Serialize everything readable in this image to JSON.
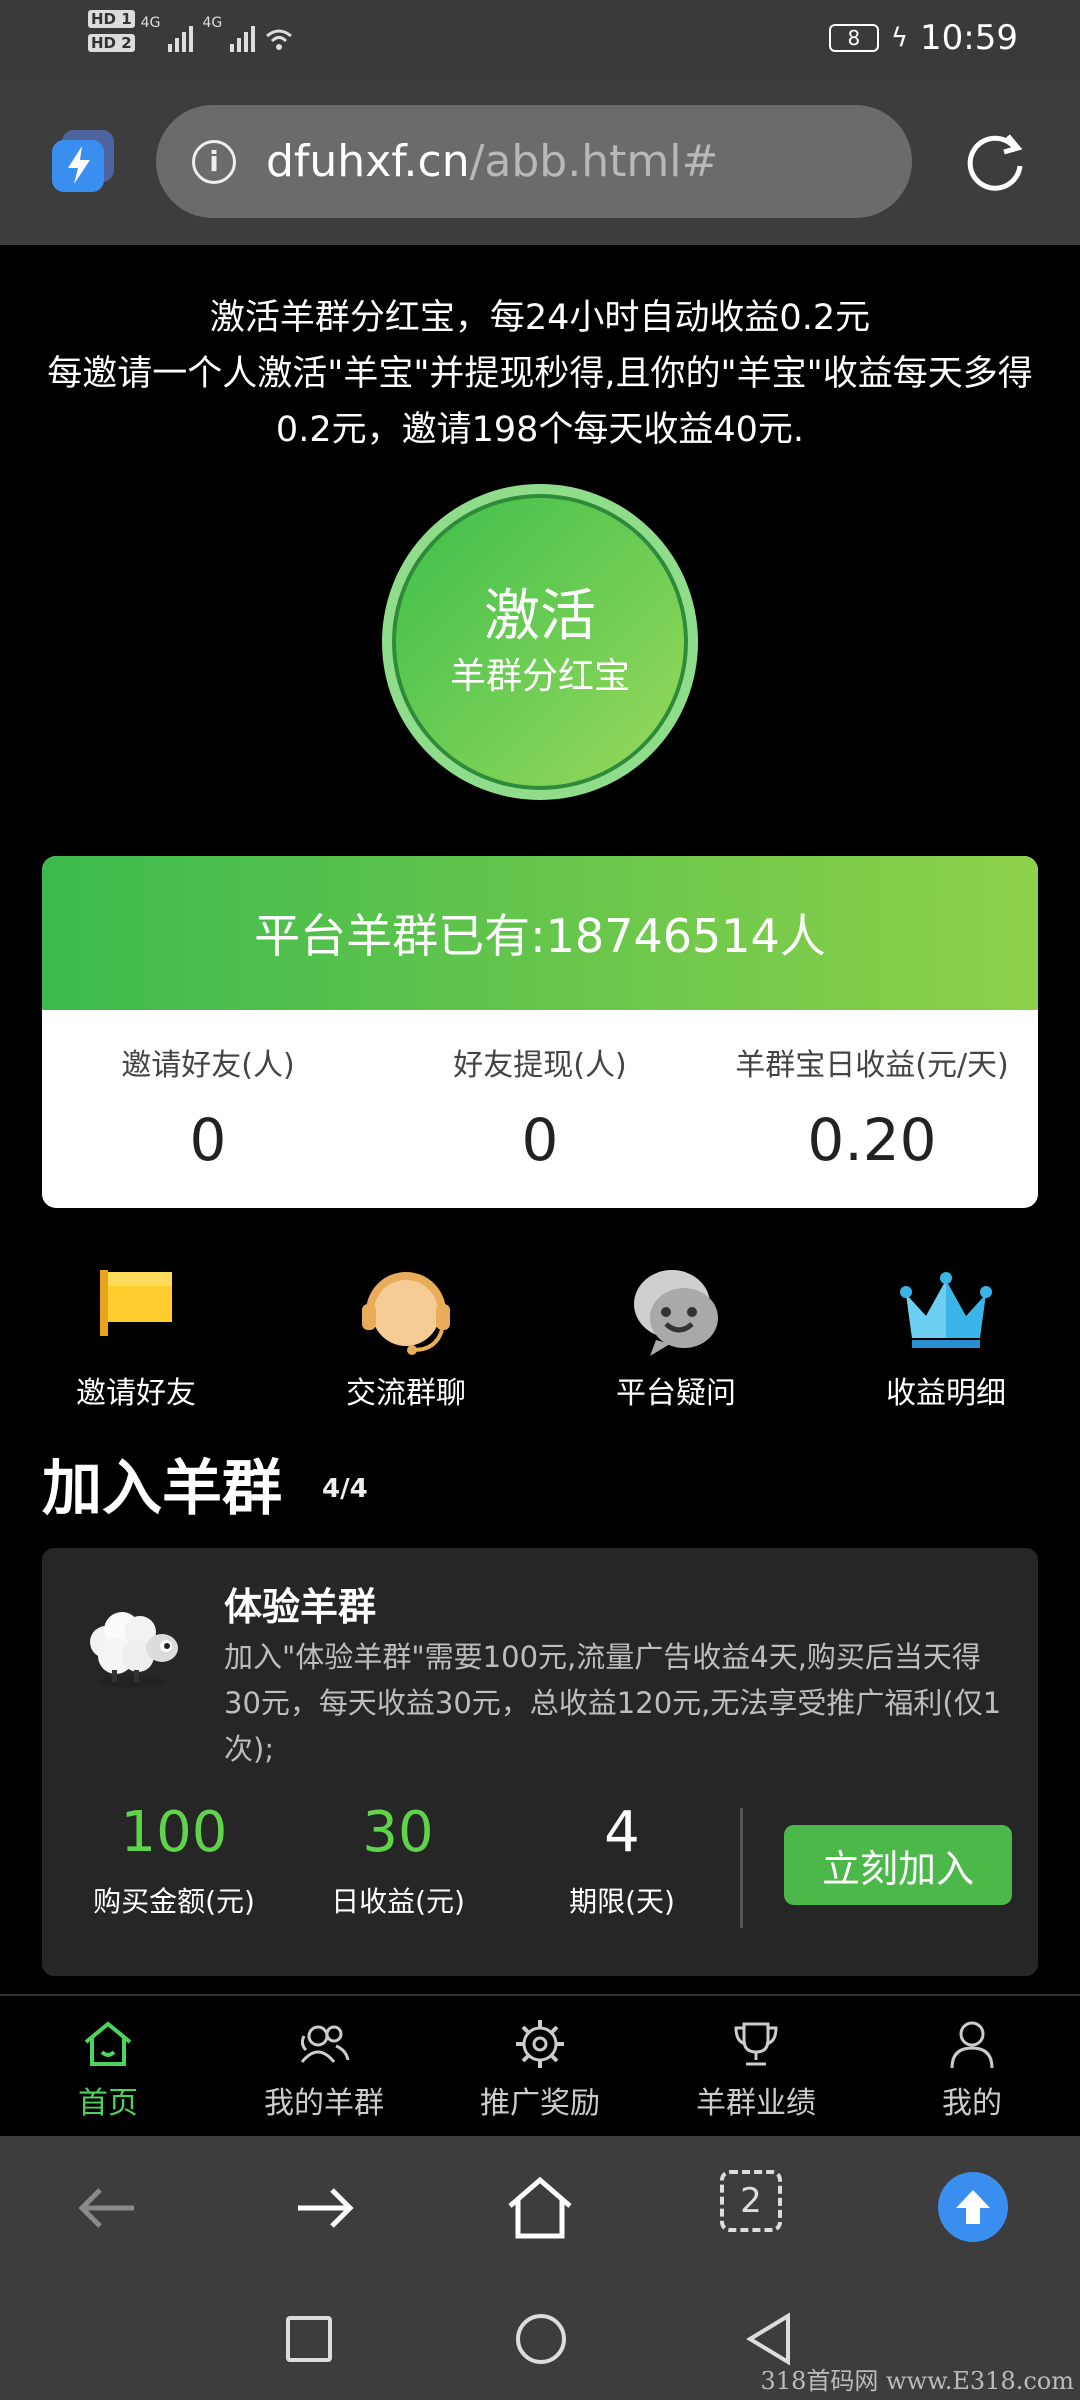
{
  "status_bar": {
    "sim1": "HD 1",
    "sim2": "HD 2",
    "net1": "4G",
    "net2": "4G",
    "battery": "8",
    "time": "10:59"
  },
  "browser": {
    "url_domain": "dfuhxf.cn",
    "url_path": "/abb.html#"
  },
  "intro": {
    "line1": "激活羊群分红宝，每24小时自动收益0.2元",
    "line2": "每邀请一个人激活\"羊宝\"并提现秒得,且你的\"羊宝\"收益每天多得0.2元，邀请198个每天收益40元."
  },
  "activate": {
    "main": "激活",
    "sub": "羊群分红宝"
  },
  "stats": {
    "headline": "平台羊群已有:18746514人",
    "items": [
      {
        "label": "邀请好友(人)",
        "value": "0"
      },
      {
        "label": "好友提现(人)",
        "value": "0"
      },
      {
        "label": "羊群宝日收益(元/天)",
        "value": "0.20"
      }
    ]
  },
  "quick_links": [
    {
      "label": "邀请好友",
      "icon": "flag-icon"
    },
    {
      "label": "交流群聊",
      "icon": "headset-icon"
    },
    {
      "label": "平台疑问",
      "icon": "chat-icon"
    },
    {
      "label": "收益明细",
      "icon": "crown-icon"
    }
  ],
  "join": {
    "title": "加入羊群",
    "count": "4/4"
  },
  "package": {
    "title": "体验羊群",
    "description": "加入\"体验羊群\"需要100元,流量广告收益4天,购买后当天得30元，每天收益30元，总收益120元,无法享受推广福利(仅1次);",
    "stats": [
      {
        "value": "100",
        "label": "购买金额(元)"
      },
      {
        "value": "30",
        "label": "日收益(元)"
      },
      {
        "value": "4",
        "label": "期限(天)"
      }
    ],
    "button": "立刻加入"
  },
  "tabs": [
    {
      "label": "首页",
      "icon": "home-icon",
      "active": true
    },
    {
      "label": "我的羊群",
      "icon": "users-icon"
    },
    {
      "label": "推广奖励",
      "icon": "gear-icon"
    },
    {
      "label": "羊群业绩",
      "icon": "trophy-icon"
    },
    {
      "label": "我的",
      "icon": "user-icon"
    }
  ],
  "browser_toolbar": {
    "tab_count": "2"
  },
  "watermark": "318首码网 www.E318.com",
  "colors": {
    "accent_green": "#4cb84a",
    "value_green": "#5fd34a",
    "upload_blue": "#3a8ef0"
  }
}
